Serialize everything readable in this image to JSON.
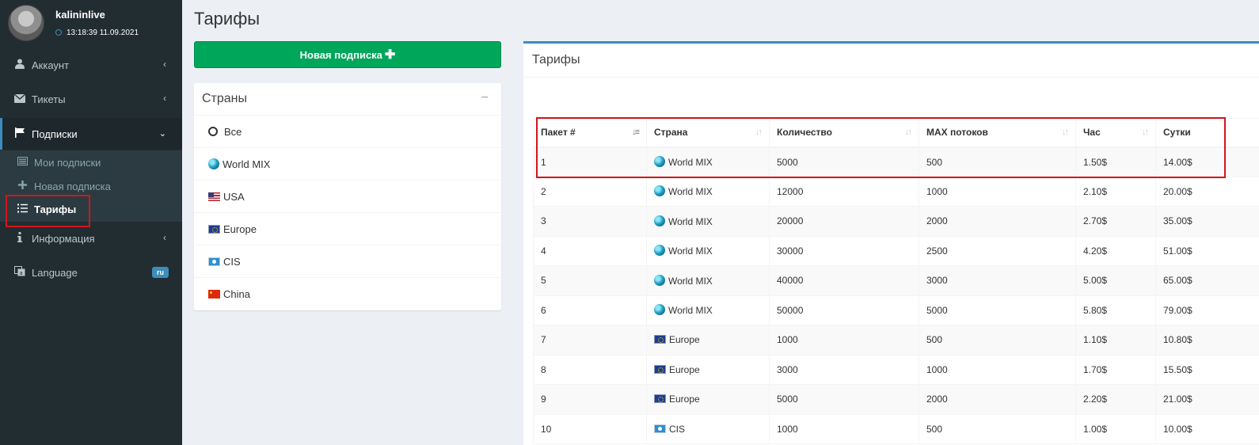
{
  "user": {
    "name": "kalininlive",
    "time": "13:18:39 11.09.2021"
  },
  "menu": {
    "account": "Аккаунт",
    "tickets": "Тикеты",
    "subscriptions": "Подписки",
    "sub_my": "Мои подписки",
    "sub_new": "Новая подписка",
    "sub_tariffs": "Тарифы",
    "info": "Информация",
    "language": "Language",
    "language_badge": "ru"
  },
  "page": {
    "title": "Тарифы",
    "new_button": "Новая подписка"
  },
  "countries": {
    "title": "Страны",
    "items": [
      "Все",
      "World MIX",
      "USA",
      "Europe",
      "CIS",
      "China"
    ]
  },
  "tariffs": {
    "title": "Тарифы",
    "columns": [
      "Пакет #",
      "Страна",
      "Количество",
      "MAX потоков",
      "Час",
      "Сутки"
    ],
    "rows": [
      [
        "1",
        "World MIX",
        "5000",
        "500",
        "1.50$",
        "14.00$"
      ],
      [
        "2",
        "World MIX",
        "12000",
        "1000",
        "2.10$",
        "20.00$"
      ],
      [
        "3",
        "World MIX",
        "20000",
        "2000",
        "2.70$",
        "35.00$"
      ],
      [
        "4",
        "World MIX",
        "30000",
        "2500",
        "4.20$",
        "51.00$"
      ],
      [
        "5",
        "World MIX",
        "40000",
        "3000",
        "5.00$",
        "65.00$"
      ],
      [
        "6",
        "World MIX",
        "50000",
        "5000",
        "5.80$",
        "79.00$"
      ],
      [
        "7",
        "Europe",
        "1000",
        "500",
        "1.10$",
        "10.80$"
      ],
      [
        "8",
        "Europe",
        "3000",
        "1000",
        "1.70$",
        "15.50$"
      ],
      [
        "9",
        "Europe",
        "5000",
        "2000",
        "2.20$",
        "21.00$"
      ],
      [
        "10",
        "CIS",
        "1000",
        "500",
        "1.00$",
        "10.00$"
      ]
    ]
  },
  "colors": {
    "sidebar": "#222d32",
    "accent": "#3c8dbc",
    "success": "#00a65a",
    "highlight": "#d0161c"
  }
}
